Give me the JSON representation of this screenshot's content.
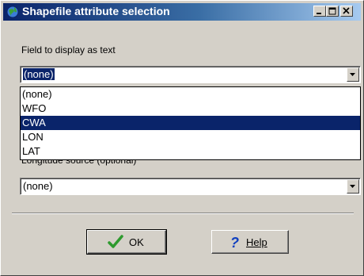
{
  "window": {
    "title": "Shapefile attribute selection"
  },
  "fields": {
    "text_field_label": "Field to display as text",
    "text_field_value": "(none)",
    "longitude_label": "Longitude source (optional)",
    "longitude_value": "(none)"
  },
  "dropdown": {
    "items": [
      "(none)",
      "WFO",
      "CWA",
      "LON",
      "LAT"
    ],
    "highlighted": "CWA"
  },
  "buttons": {
    "ok_label": "OK",
    "help_label": "Help"
  },
  "icons": {
    "app": "globe-icon",
    "ok": "checkmark-icon",
    "help": "question-mark-icon",
    "minimize": "minimize-icon",
    "maximize": "maximize-icon",
    "close": "close-icon"
  },
  "colors": {
    "title_bar": "#0a246a",
    "selection": "#0a246a",
    "face": "#d4d0c8",
    "ok_check": "#2e9a2e",
    "help_mark": "#1040c0"
  }
}
